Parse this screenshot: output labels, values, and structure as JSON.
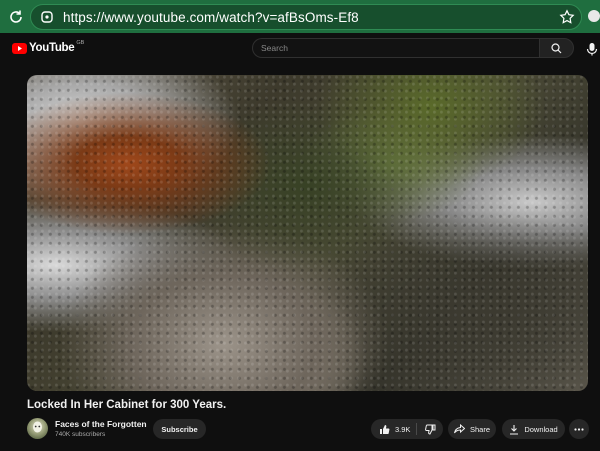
{
  "browser": {
    "url": "https://www.youtube.com/watch?v=afBsOms-Ef8"
  },
  "header": {
    "logo_text": "YouTube",
    "region": "GB",
    "search_placeholder": "Search"
  },
  "video": {
    "title": "Locked In Her Cabinet for 300 Years."
  },
  "channel": {
    "name": "Faces of the Forgotten",
    "subscribers": "740K subscribers",
    "subscribe_label": "Subscribe"
  },
  "actions": {
    "like_count": "3.9K",
    "share_label": "Share",
    "download_label": "Download"
  },
  "colors": {
    "browser_bar": "#1f6e3f",
    "background": "#0f0f0f",
    "pill": "#272727",
    "youtube_red": "#ff0000"
  },
  "icons": [
    "reload-icon",
    "site-info-icon",
    "bookmark-star-icon",
    "search-icon",
    "mic-icon",
    "like-icon",
    "dislike-icon",
    "share-icon",
    "download-icon",
    "more-icon"
  ]
}
